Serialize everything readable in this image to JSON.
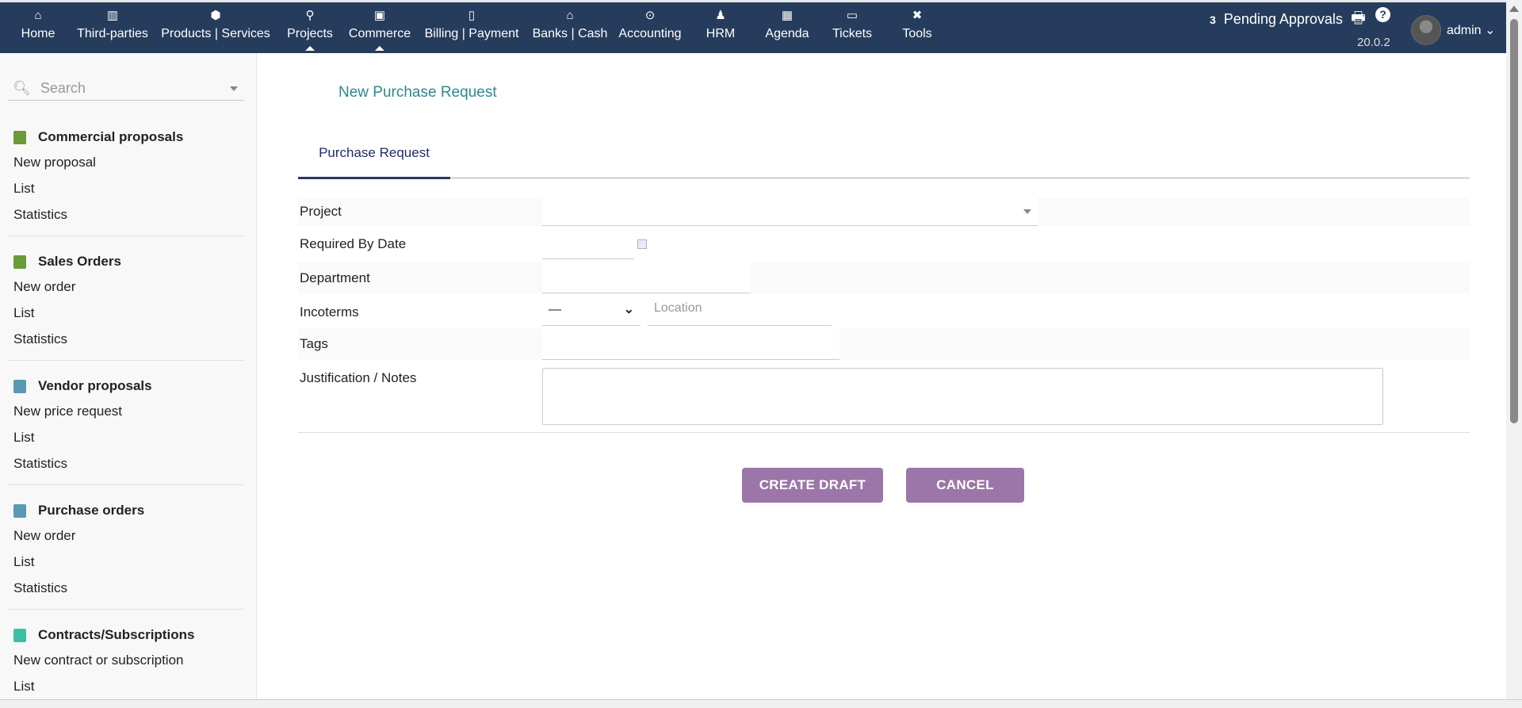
{
  "topbar": {
    "menu": [
      {
        "label": "Home",
        "icon": "home-icon",
        "glyph": "⌂"
      },
      {
        "label": "Third-parties",
        "icon": "building-icon",
        "glyph": "▥"
      },
      {
        "label": "Products | Services",
        "icon": "cube-icon",
        "glyph": "⬢"
      },
      {
        "label": "Projects",
        "icon": "sitemap-icon",
        "glyph": "⚲"
      },
      {
        "label": "Commerce",
        "icon": "suitcase-icon",
        "glyph": "▣"
      },
      {
        "label": "Billing | Payment",
        "icon": "invoice-icon",
        "glyph": "▯"
      },
      {
        "label": "Banks | Cash",
        "icon": "bank-icon",
        "glyph": "⌂"
      },
      {
        "label": "Accounting",
        "icon": "search-dollar-icon",
        "glyph": "⊙"
      },
      {
        "label": "HRM",
        "icon": "user-tie-icon",
        "glyph": "♟"
      },
      {
        "label": "Agenda",
        "icon": "calendar-icon",
        "glyph": "▦"
      },
      {
        "label": "Tickets",
        "icon": "ticket-icon",
        "glyph": "▭"
      },
      {
        "label": "Tools",
        "icon": "tools-icon",
        "glyph": "✖"
      }
    ],
    "pending_count": "3",
    "pending_label": "Pending Approvals",
    "version": "20.0.2",
    "user": "admin"
  },
  "sidebar": {
    "search_placeholder": "Search",
    "sections": [
      {
        "title": "Commercial proposals",
        "color": "#6a9a3a",
        "items": [
          "New proposal",
          "List",
          "Statistics"
        ]
      },
      {
        "title": "Sales Orders",
        "color": "#6a9a3a",
        "items": [
          "New order",
          "List",
          "Statistics"
        ]
      },
      {
        "title": "Vendor proposals",
        "color": "#5a9ab0",
        "items": [
          "New price request",
          "List",
          "Statistics"
        ]
      },
      {
        "title": "Purchase orders",
        "color": "#5a9ab0",
        "items": [
          "New order",
          "List",
          "Statistics"
        ]
      },
      {
        "title": "Contracts/Subscriptions",
        "color": "#3dbfa5",
        "items": [
          "New contract or subscription",
          "List"
        ]
      }
    ]
  },
  "main": {
    "title": "New Purchase Request",
    "tab": "Purchase Request",
    "fields": {
      "project": "Project",
      "required_by": "Required By Date",
      "department": "Department",
      "incoterms": "Incoterms",
      "incoterms_value": "—",
      "location_placeholder": "Location",
      "tags": "Tags",
      "justification": "Justification / Notes"
    },
    "create_label": "CREATE DRAFT",
    "cancel_label": "CANCEL"
  }
}
